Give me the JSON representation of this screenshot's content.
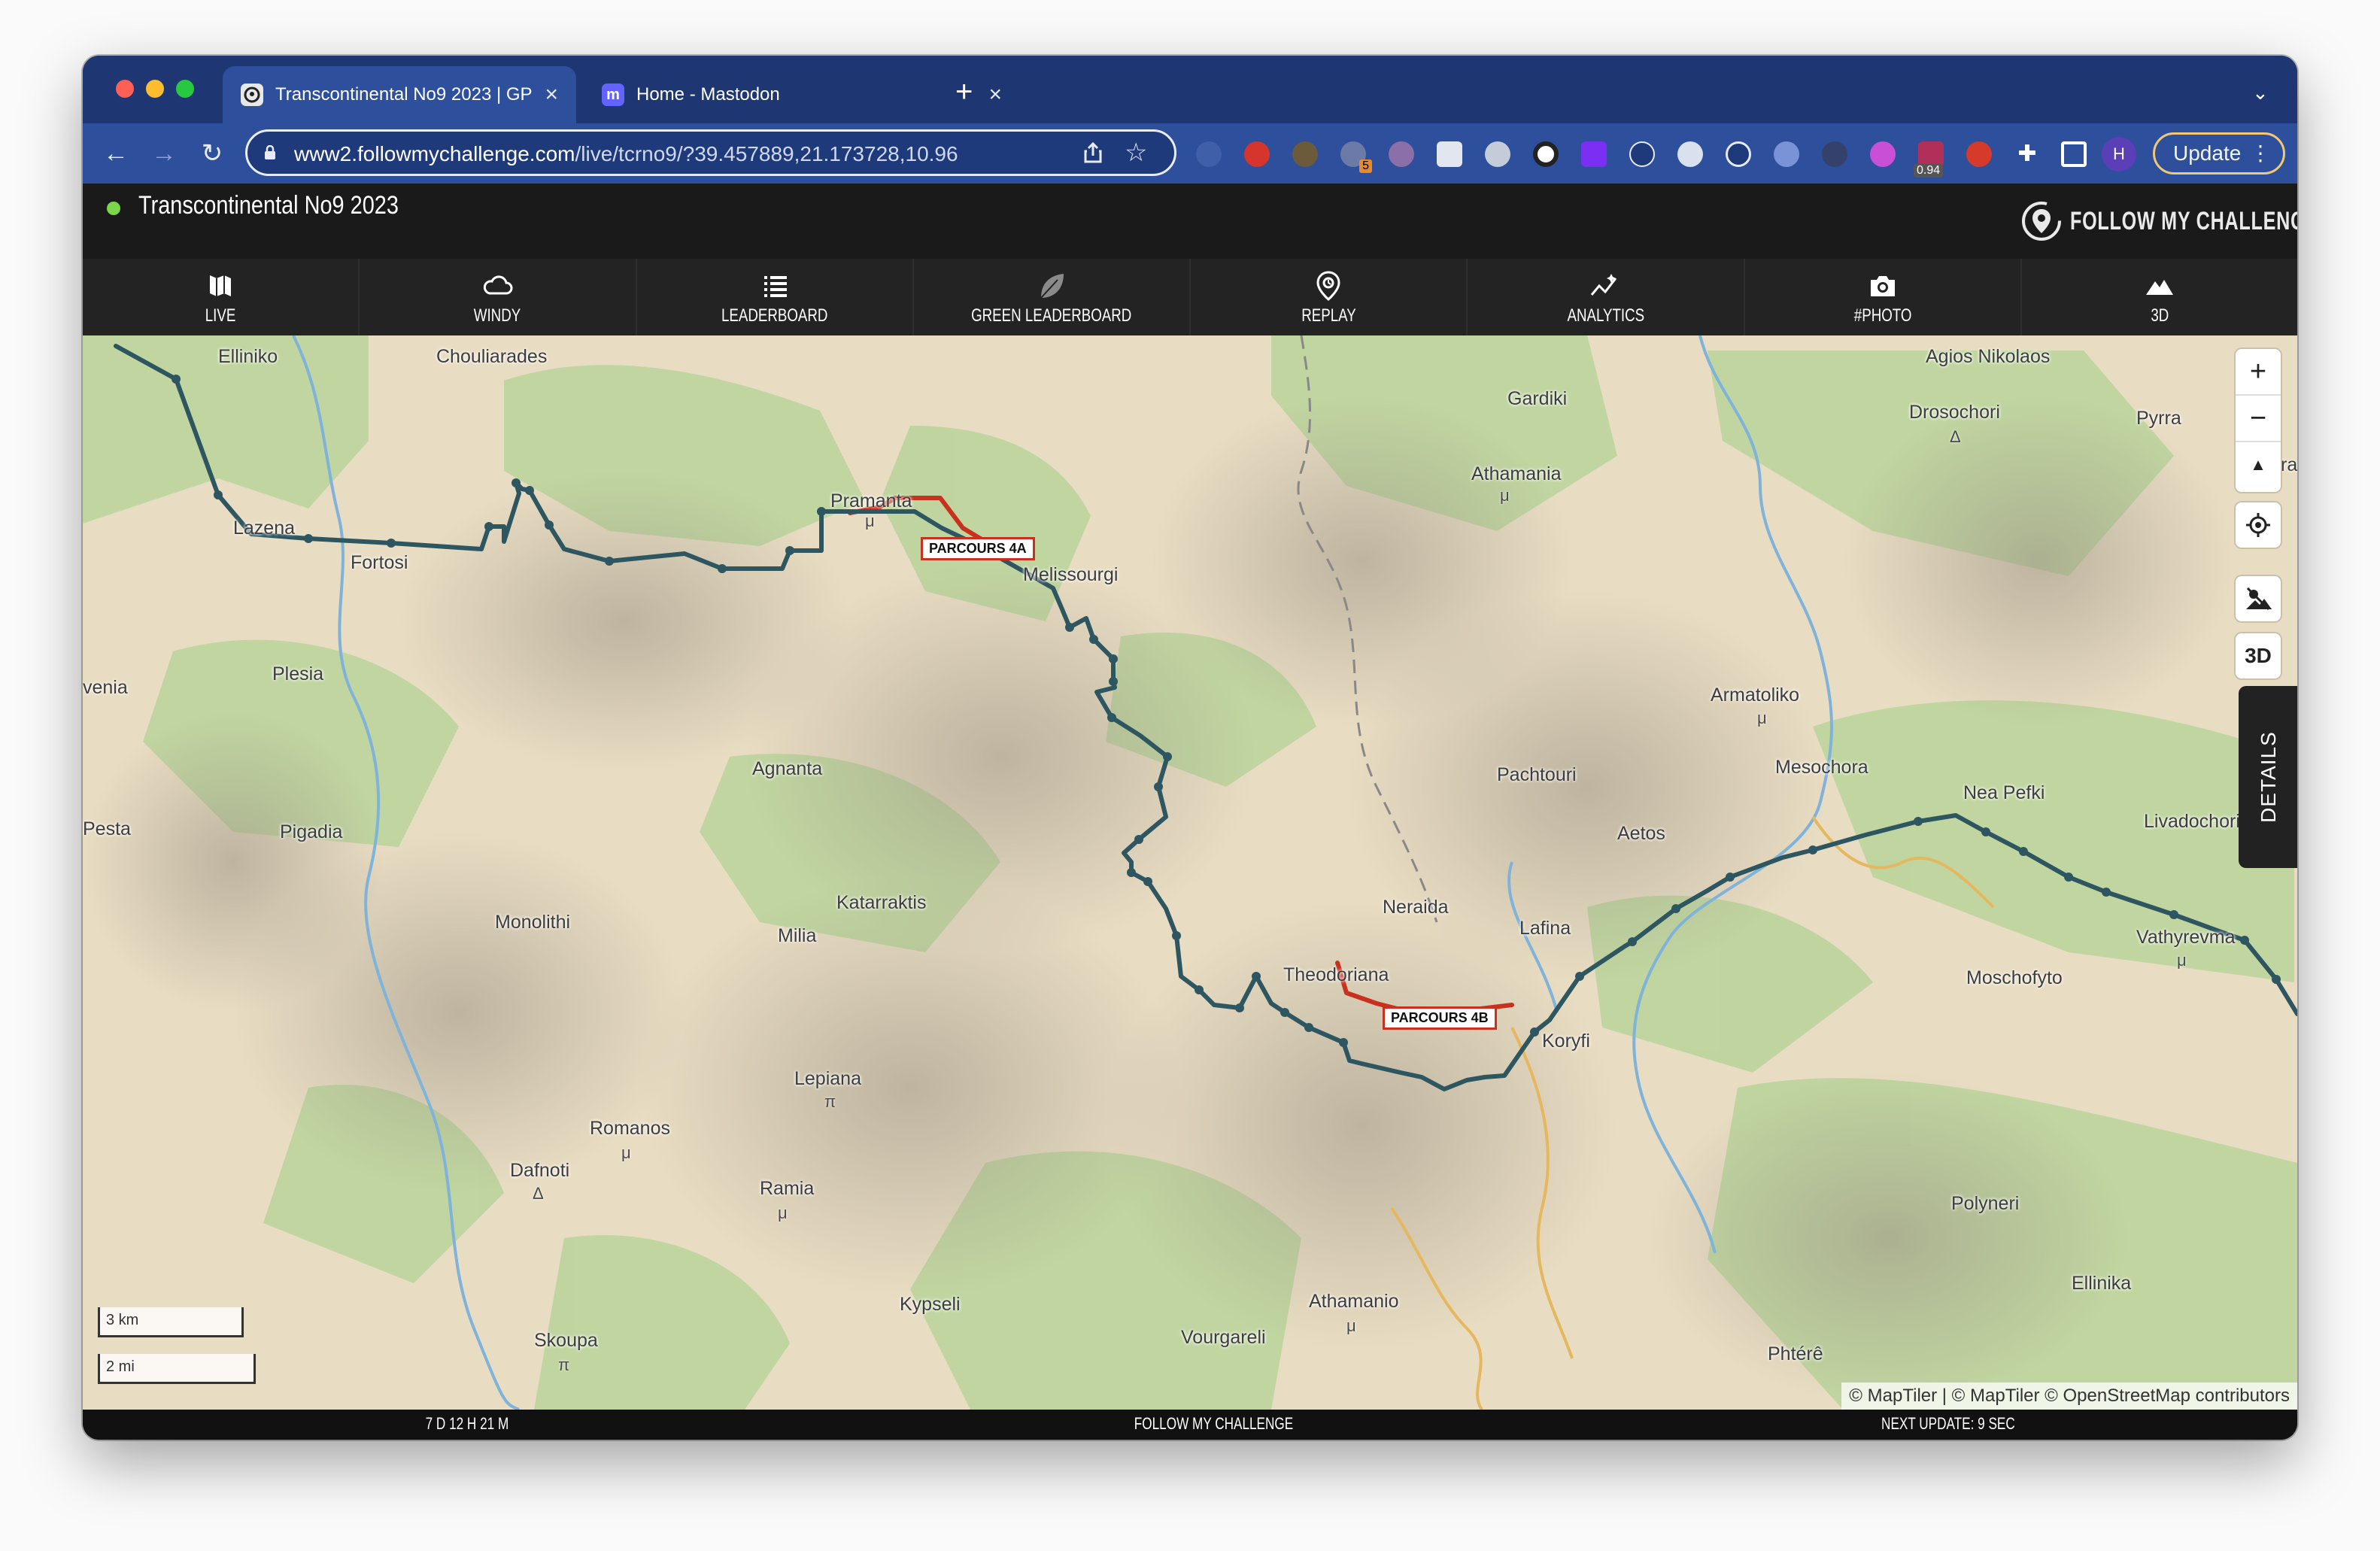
{
  "browser": {
    "tabs": [
      {
        "title": "Transcontinental No9 2023 | GP",
        "active": true
      },
      {
        "title": "Home - Mastodon",
        "active": false
      }
    ],
    "new_tab_label": "+",
    "tab_menu_label": "⌄",
    "url_host": "www2.followmychallenge.com",
    "url_path": "/live/tcrno9/?39.457889,21.173728,10.96",
    "extension_badges": [
      "5",
      "0.94"
    ],
    "profile_initial": "H",
    "update_label": "Update",
    "accent": "#2d4f9c",
    "tabstrip_color": "#1e3773"
  },
  "header": {
    "event_title": "Transcontinental No9 2023",
    "brand": "FOLLOW MY CHALLENGE",
    "status_color": "#7cd64a"
  },
  "menu": {
    "items": [
      {
        "label": "LIVE",
        "icon": "map-icon"
      },
      {
        "label": "WINDY",
        "icon": "cloud-icon"
      },
      {
        "label": "LEADERBOARD",
        "icon": "list-icon"
      },
      {
        "label": "GREEN LEADERBOARD",
        "icon": "leaf-icon"
      },
      {
        "label": "REPLAY",
        "icon": "replay-pin-icon"
      },
      {
        "label": "ANALYTICS",
        "icon": "analytics-icon"
      },
      {
        "label": "#PHOTO",
        "icon": "camera-icon"
      },
      {
        "label": "3D",
        "icon": "mountain-icon"
      }
    ]
  },
  "map": {
    "places": [
      "Elliniko",
      "Chouliarades",
      "Lazena",
      "Fortosi",
      "Plesia",
      "venia",
      "Pesta",
      "Pigadia",
      "Pramanta",
      "Melissourgi",
      "Agnanta",
      "Katarraktis",
      "Milia",
      "Monolithi",
      "Lepiana",
      "Romanos",
      "Dafnoti",
      "Ramia",
      "Kypseli",
      "Skoupa",
      "Vourgareli",
      "Athamanio",
      "Gardiki",
      "Athamania",
      "Agios Nikolaos",
      "Drosochori",
      "Pyrra",
      "ra",
      "Armatoliko",
      "Pachtouri",
      "Mesochora",
      "Nea Pefki",
      "Livadochori",
      "Aetos",
      "Neraida",
      "Lafina",
      "Theodoriana",
      "Koryfi",
      "Vathyrevma",
      "Moschofyto",
      "Polyneri",
      "Ellinika",
      "Phtérê"
    ],
    "parcours": [
      "PARCOURS 4A",
      "PARCOURS 4B"
    ],
    "route_color": "#2d5661",
    "parcours_color": "#c8311e",
    "controls": {
      "zoom_in": "+",
      "zoom_out": "−",
      "north": "▲",
      "locate": "locate-icon",
      "terrain": "terrain-toggle-icon",
      "threed": "3D"
    },
    "details_label": "DETAILS",
    "scale_metric": "3 km",
    "scale_imperial": "2 mi",
    "attribution": "© MapTiler | © MapTiler © OpenStreetMap contributors"
  },
  "status": {
    "elapsed": "7 D 12 H 21 M",
    "center": "FOLLOW MY CHALLENGE",
    "next_update": "NEXT UPDATE: 9 SEC"
  }
}
